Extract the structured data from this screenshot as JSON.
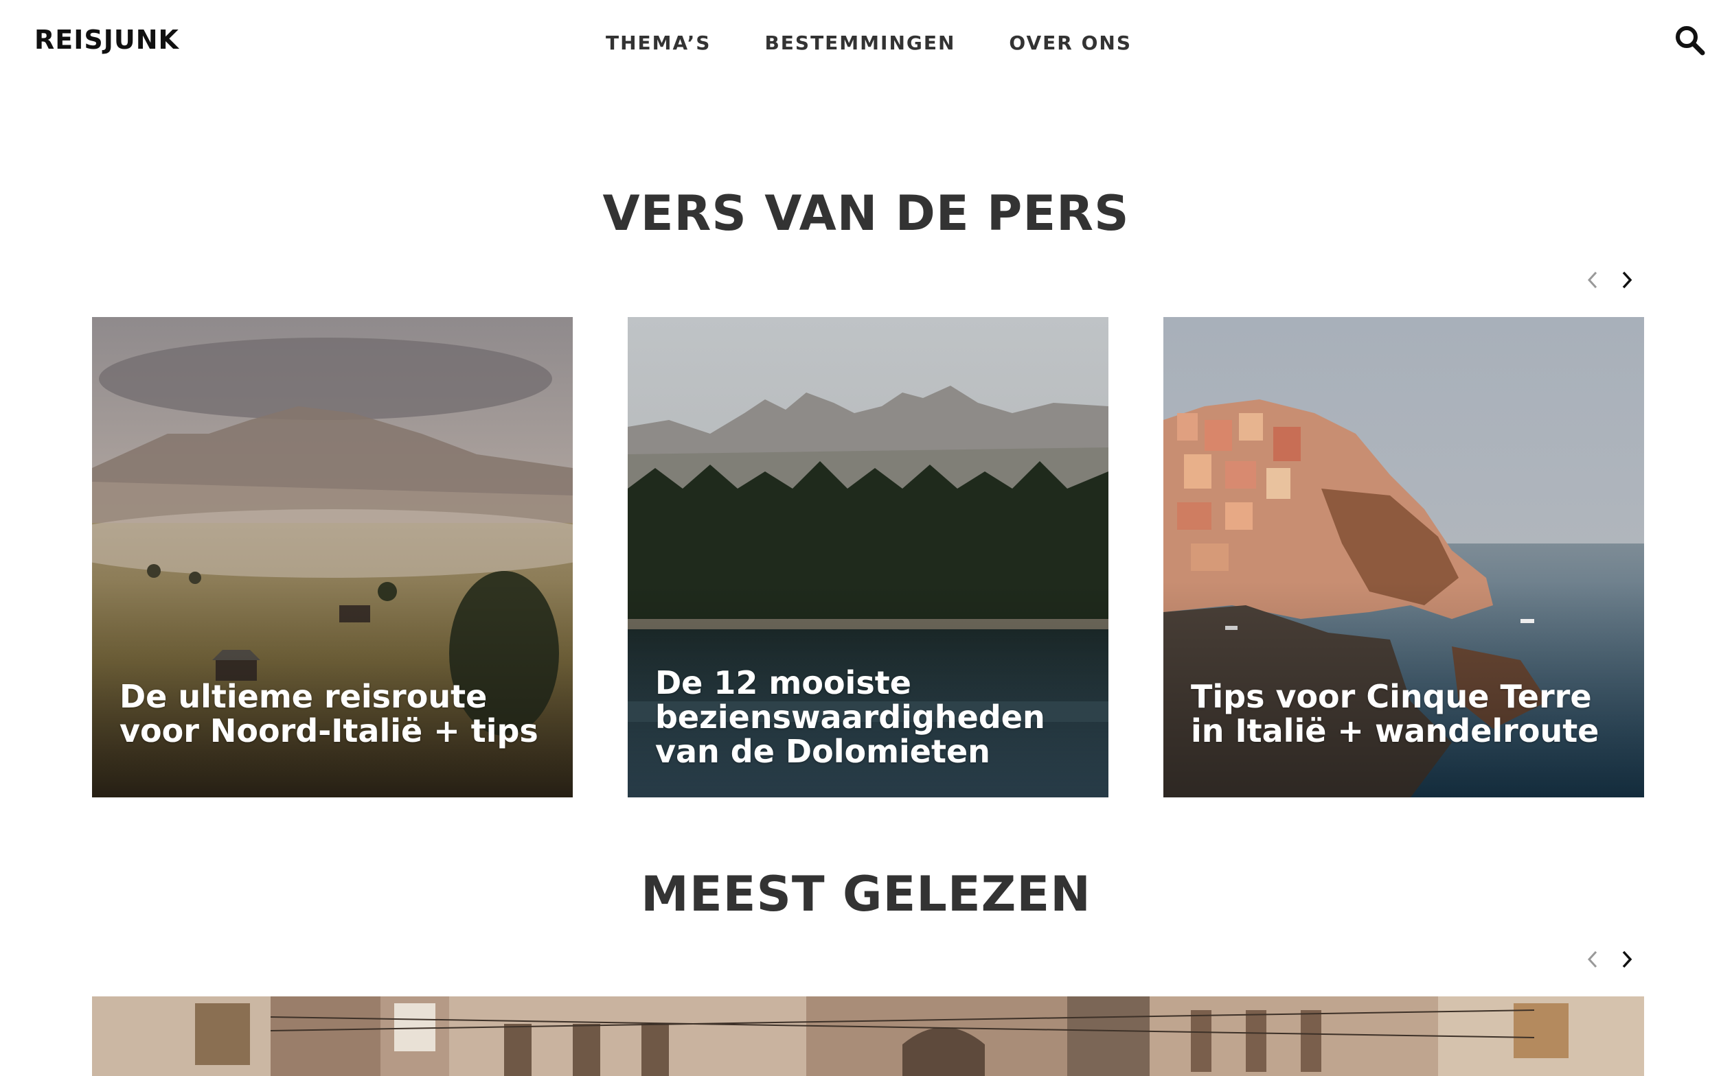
{
  "header": {
    "logo": "REISJUNK",
    "nav": [
      "THEMA’S",
      "BESTEMMINGEN",
      "OVER ONS"
    ],
    "search_icon": "search-icon"
  },
  "section_new": {
    "title": "VERS VAN DE PERS",
    "prev_icon": "chevron-left-icon",
    "next_icon": "chevron-right-icon",
    "cards": [
      {
        "title": "De ultieme reisroute voor Noord-Italië + tips",
        "image": "misty-alpine-meadow-photo"
      },
      {
        "title": "De 12 mooiste bezienswaardigheden van de Dolomieten",
        "image": "mountain-lake-forest-photo"
      },
      {
        "title": "Tips voor Cinque Terre in Italië + wandelroute",
        "image": "cliffside-village-sea-photo"
      }
    ]
  },
  "section_popular": {
    "title": "MEEST GELEZEN",
    "prev_icon": "chevron-left-icon",
    "next_icon": "chevron-right-icon",
    "banner_image": "old-town-street-photo"
  },
  "colors": {
    "text": "#333333",
    "logo": "#111111",
    "background": "#ffffff",
    "card_title": "#ffffff"
  }
}
